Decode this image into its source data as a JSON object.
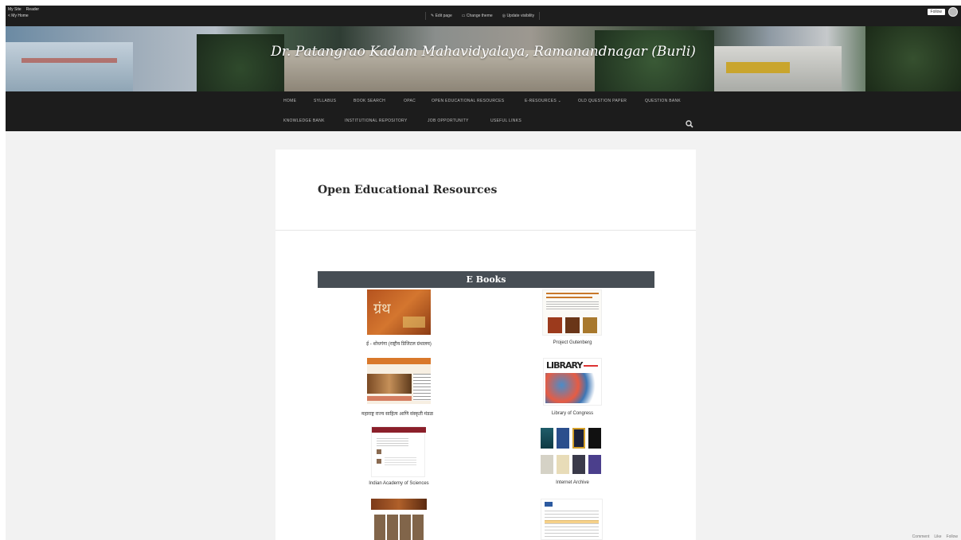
{
  "adminbar": {
    "my_site": "My Site",
    "reader": "Reader",
    "my_home": "< My Home",
    "edit_page": "Edit page",
    "change_theme": "Change theme",
    "update_visibility": "Update visibility",
    "follow": "Follow"
  },
  "site": {
    "title": "Dr. Patangrao Kadam Mahavidyalaya, Ramanandnagar (Burli)"
  },
  "nav": {
    "row1": [
      "HOME",
      "SYLLABUS",
      "BOOK SEARCH",
      "OPAC",
      "OPEN EDUCATIONAL RESOURCES",
      "E-RESOURCES ⌄",
      "OLD QUESTION PAPER",
      "QUESTION BANK"
    ],
    "row2": [
      "KNOWLEDGE BANK",
      "INSTITUTIONAL REPOSITORY",
      "JOB OPPORTUNITY",
      "USEFUL LINKS"
    ]
  },
  "page": {
    "title": "Open Educational Resources",
    "section": "E Books"
  },
  "resources": [
    {
      "label": "ई - शोधगंगा (राष्ट्रीय डिजिटल ग्रंथालय)"
    },
    {
      "label": "Project Gutenberg"
    },
    {
      "label": "महाराष्ट्र राज्य साहित्य आणि संस्कृती मंडळ"
    },
    {
      "label": "Library of Congress"
    },
    {
      "label": "Indian Academy of Sciences"
    },
    {
      "label": "Internet Archive"
    },
    {
      "label": ""
    },
    {
      "label": ""
    }
  ],
  "footer": {
    "links": [
      "Comment",
      "Like",
      "Follow"
    ]
  },
  "colors": {
    "adminbar": "#1d1d1d",
    "nav": "#1c1c1c",
    "section_bar": "#474e55",
    "page_bg": "#f2f2f2"
  }
}
